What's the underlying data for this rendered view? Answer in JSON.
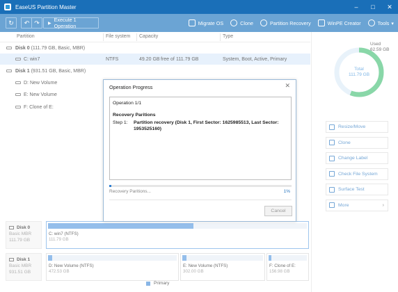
{
  "window": {
    "title": "EaseUS Partition Master",
    "controls": [
      "–",
      "□",
      "✕"
    ]
  },
  "toolbar": {
    "refresh_icon": "↻",
    "undo_icon": "↶",
    "redo_icon": "↷",
    "execute_label": "Execute 1 Operation",
    "items": [
      {
        "label": "Migrate OS",
        "icon": "migrate-os-icon"
      },
      {
        "label": "Clone",
        "icon": "clone-icon"
      },
      {
        "label": "Partition Recovery",
        "icon": "partition-recovery-icon"
      },
      {
        "label": "WinPE Creator",
        "icon": "winpe-icon"
      },
      {
        "label": "Tools",
        "icon": "tools-icon",
        "dropdown": "▾"
      }
    ]
  },
  "columns": {
    "partition": "Partition",
    "filesystem": "File system",
    "capacity": "Capacity",
    "type": "Type"
  },
  "disks": [
    {
      "label": "Disk 0",
      "info": "(111.79 GB, Basic, MBR)"
    },
    {
      "label": "Disk 1",
      "info": "(931.51 GB, Basic, MBR)"
    }
  ],
  "partitions": [
    {
      "name": "C: win7",
      "filesystem": "NTFS",
      "used": "49.20 GB",
      "free_of": "free of",
      "total": "111.79 GB",
      "type": "System, Boot, Active, Primary"
    },
    {
      "name": "D: New Volume"
    },
    {
      "name": "E: New Volume"
    },
    {
      "name": "F: Clone of E:"
    }
  ],
  "sidebar": {
    "used_label": "Used",
    "used_value": "62.59 GB",
    "total_label": "Total",
    "total_value": "111.79 GB",
    "used_fraction": 0.56,
    "used_color": "#4ac27a",
    "free_color": "#dcebf8",
    "actions": [
      {
        "label": "Resize/Move",
        "icon": "resize-move-icon"
      },
      {
        "label": "Clone",
        "icon": "clone-icon"
      },
      {
        "label": "Change Label",
        "icon": "change-label-icon"
      },
      {
        "label": "Check File System",
        "icon": "check-file-system-icon"
      },
      {
        "label": "Surface Test",
        "icon": "surface-test-icon"
      },
      {
        "label": "More",
        "icon": "more-icon",
        "chevron": "›"
      }
    ]
  },
  "diskmap": {
    "disk0": {
      "name": "Disk 0",
      "type": "Basic MBR",
      "size": "111.79 GB",
      "parts": [
        {
          "label": "C: win7 (NTFS)",
          "size": "111.79 GB",
          "used_fraction": 0.56
        }
      ]
    },
    "disk1": {
      "name": "Disk 1",
      "type": "Basic MBR",
      "size": "931.51 GB",
      "parts": [
        {
          "label": "D: New Volume (NTFS)",
          "size": "472.53 GB"
        },
        {
          "label": "E: New Volume (NTFS)",
          "size": "302.00 GB"
        },
        {
          "label": "F: Clone of E:",
          "size": "156.98 GB"
        }
      ]
    },
    "legend": "Primary"
  },
  "modal": {
    "title": "Operation Progress",
    "close_icon": "✕",
    "operation": "Operation 1/1",
    "heading": "Recovery Paritions",
    "step_label": "Step 1:",
    "step_text_line1": "Partition recovery (Disk 1, First Sector: 1625985513, Last Sector:",
    "step_text_line2": "1953525160)",
    "progress_text": "Recovery Paritions...",
    "progress_pct_label": "1%",
    "progress_fraction": 0.01,
    "cancel_label": "Cancel"
  }
}
